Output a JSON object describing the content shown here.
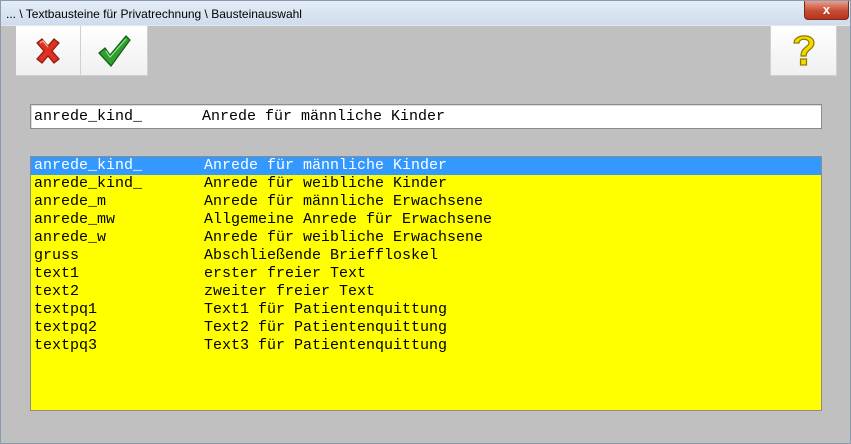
{
  "window": {
    "title": "... \\ Textbausteine für Privatrechnung \\ Bausteinauswahl",
    "close_label": "x"
  },
  "toolbar": {
    "cancel_icon": "red-x-icon",
    "confirm_icon": "green-check-icon",
    "help_icon": "yellow-question-mark-icon"
  },
  "selection": {
    "key": "anrede_kind_",
    "description": "Anrede für männliche Kinder"
  },
  "list": {
    "selected_index": 0,
    "items": [
      {
        "key": "anrede_kind_",
        "description": "Anrede für männliche Kinder"
      },
      {
        "key": "anrede_kind_",
        "description": "Anrede für weibliche Kinder"
      },
      {
        "key": "anrede_m",
        "description": "Anrede für männliche Erwachsene"
      },
      {
        "key": "anrede_mw",
        "description": "Allgemeine Anrede für Erwachsene"
      },
      {
        "key": "anrede_w",
        "description": "Anrede für weibliche Erwachsene"
      },
      {
        "key": "gruss",
        "description": "Abschließende Brieffloskel"
      },
      {
        "key": "text1",
        "description": "erster freier Text"
      },
      {
        "key": "text2",
        "description": "zweiter freier Text"
      },
      {
        "key": "textpq1",
        "description": "Text1 für Patientenquittung"
      },
      {
        "key": "textpq2",
        "description": "Text2 für Patientenquittung"
      },
      {
        "key": "textpq3",
        "description": "Text3 für Patientenquittung"
      }
    ]
  },
  "colors": {
    "list_background": "#ffff00",
    "selection_highlight": "#3399ff",
    "window_background": "#c0c0c0"
  }
}
